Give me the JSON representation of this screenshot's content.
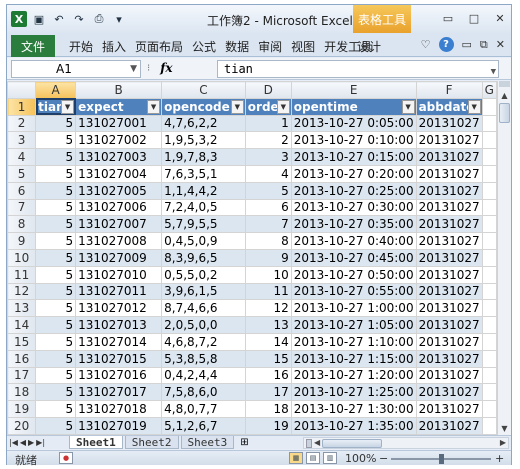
{
  "title": "工作簿2 - Microsoft Excel",
  "context_tab_group": "表格工具",
  "ribbon": {
    "file_tab": "文件",
    "tabs": [
      "开始",
      "插入",
      "页面布局",
      "公式",
      "数据",
      "审阅",
      "视图",
      "开发工具"
    ],
    "design_tab": "设计"
  },
  "formula_bar": {
    "name_box": "A1",
    "fx": "fx",
    "formula": "tian"
  },
  "columns": [
    "A",
    "B",
    "C",
    "D",
    "E",
    "F",
    "G"
  ],
  "table": {
    "headers": [
      "tian",
      "expect",
      "opencode",
      "order",
      "opentime",
      "abbdate"
    ],
    "rows": [
      [
        "5",
        "131027001",
        "4,7,6,2,2",
        "1",
        "2013-10-27 0:05:00",
        "20131027"
      ],
      [
        "5",
        "131027002",
        "1,9,5,3,2",
        "2",
        "2013-10-27 0:10:00",
        "20131027"
      ],
      [
        "5",
        "131027003",
        "1,9,7,8,3",
        "3",
        "2013-10-27 0:15:00",
        "20131027"
      ],
      [
        "5",
        "131027004",
        "7,6,3,5,1",
        "4",
        "2013-10-27 0:20:00",
        "20131027"
      ],
      [
        "5",
        "131027005",
        "1,1,4,4,2",
        "5",
        "2013-10-27 0:25:00",
        "20131027"
      ],
      [
        "5",
        "131027006",
        "7,2,4,0,5",
        "6",
        "2013-10-27 0:30:00",
        "20131027"
      ],
      [
        "5",
        "131027007",
        "5,7,9,5,5",
        "7",
        "2013-10-27 0:35:00",
        "20131027"
      ],
      [
        "5",
        "131027008",
        "0,4,5,0,9",
        "8",
        "2013-10-27 0:40:00",
        "20131027"
      ],
      [
        "5",
        "131027009",
        "8,3,9,6,5",
        "9",
        "2013-10-27 0:45:00",
        "20131027"
      ],
      [
        "5",
        "131027010",
        "0,5,5,0,2",
        "10",
        "2013-10-27 0:50:00",
        "20131027"
      ],
      [
        "5",
        "131027011",
        "3,9,6,1,5",
        "11",
        "2013-10-27 0:55:00",
        "20131027"
      ],
      [
        "5",
        "131027012",
        "8,7,4,6,6",
        "12",
        "2013-10-27 1:00:00",
        "20131027"
      ],
      [
        "5",
        "131027013",
        "2,0,5,0,0",
        "13",
        "2013-10-27 1:05:00",
        "20131027"
      ],
      [
        "5",
        "131027014",
        "4,6,8,7,2",
        "14",
        "2013-10-27 1:10:00",
        "20131027"
      ],
      [
        "5",
        "131027015",
        "5,3,8,5,8",
        "15",
        "2013-10-27 1:15:00",
        "20131027"
      ],
      [
        "5",
        "131027016",
        "0,4,2,4,4",
        "16",
        "2013-10-27 1:20:00",
        "20131027"
      ],
      [
        "5",
        "131027017",
        "7,5,8,6,0",
        "17",
        "2013-10-27 1:25:00",
        "20131027"
      ],
      [
        "5",
        "131027018",
        "4,8,0,7,7",
        "18",
        "2013-10-27 1:30:00",
        "20131027"
      ],
      [
        "5",
        "131027019",
        "5,1,2,6,7",
        "19",
        "2013-10-27 1:35:00",
        "20131027"
      ]
    ]
  },
  "row_numbers": [
    "1",
    "2",
    "3",
    "4",
    "5",
    "6",
    "7",
    "8",
    "9",
    "10",
    "11",
    "12",
    "13",
    "14",
    "15",
    "16",
    "17",
    "18",
    "19",
    "20"
  ],
  "sheets": [
    "Sheet1",
    "Sheet2",
    "Sheet3"
  ],
  "active_sheet": "Sheet1",
  "status": {
    "ready": "就绪",
    "zoom": "100%",
    "zoom_fraction": 0.5
  },
  "colors": {
    "header_fill": "#4f81bd",
    "band_fill": "#dce6f1",
    "file_tab": "#2b7d3e",
    "context_tab": "#e9a12c"
  },
  "icons": {
    "excel": "excel-logo-icon",
    "save": "save-icon",
    "undo": "undo-icon",
    "redo": "redo-icon",
    "print_preview": "print-preview-icon",
    "help": "help-icon"
  }
}
